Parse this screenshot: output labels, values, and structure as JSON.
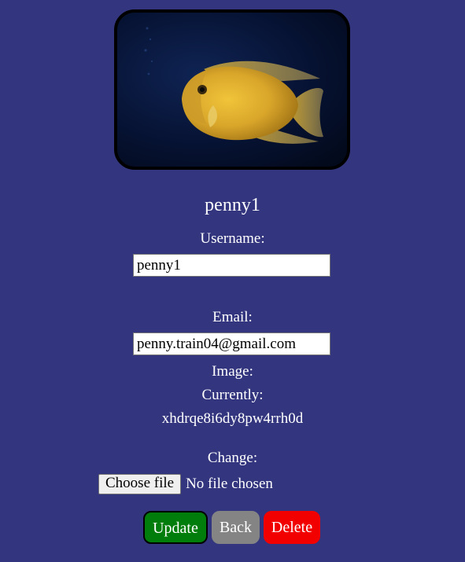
{
  "profile": {
    "name": "penny1",
    "photo_subject": "yellow fish on dark blue background"
  },
  "form": {
    "username_label": "Username:",
    "username_value": "penny1",
    "email_label": "Email:",
    "email_value": "penny.train04@gmail.com",
    "image_label": "Image:",
    "currently_label": "Currently:",
    "current_image": "xhdrqe8i6dy8pw4rrh0d",
    "change_label": "Change:",
    "choose_file_label": "Choose file",
    "file_status": "No file chosen"
  },
  "actions": {
    "update_label": "Update",
    "back_label": "Back",
    "delete_label": "Delete"
  },
  "colors": {
    "background": "#33367f",
    "update": "#007d0a",
    "back": "#848484",
    "delete": "#f20000"
  }
}
